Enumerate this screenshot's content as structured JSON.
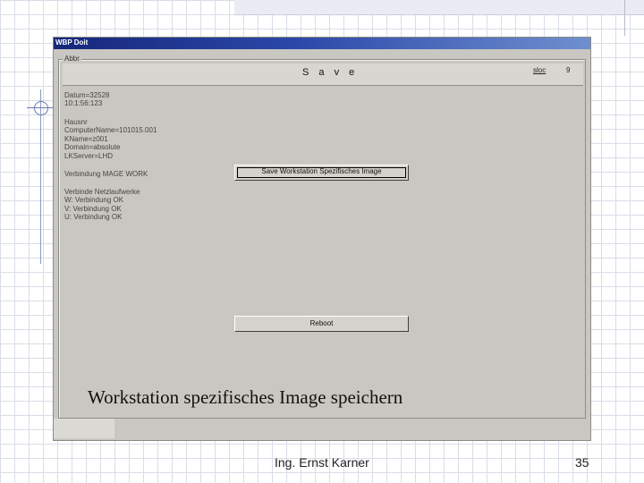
{
  "window": {
    "title": "WBP Doit"
  },
  "group": {
    "label": "Abbr"
  },
  "header": {
    "title": "S a v e",
    "link1": "sloc",
    "link2": "9"
  },
  "info_lines": [
    "Datum=32528",
    "10:1:56:123",
    "Hausnr",
    "ComputerName=101015.001",
    "KName=z001",
    "Domain=absolute",
    "LKServer=LHD",
    "Verbindung MAGE WORK",
    "Verbinde Netzlaufwerke",
    "W: Verbindung OK",
    "V: Verbindung OK",
    "U: Verbindung OK"
  ],
  "buttons": {
    "save": "Save Workstation Spezifisches Image",
    "restart": "Reboot"
  },
  "caption": "Workstation spezifisches Image speichern",
  "footer": {
    "author": "Ing. Ernst Karner",
    "page": "35"
  }
}
